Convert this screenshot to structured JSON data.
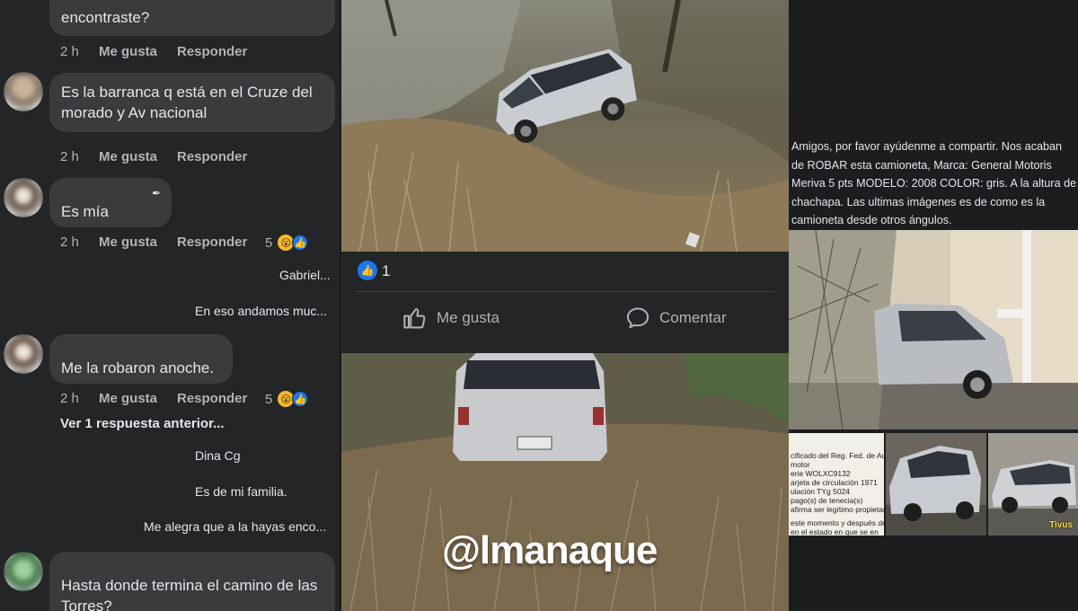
{
  "comments": [
    {
      "text_line2": "encontraste?",
      "time": "2 h",
      "like": "Me gusta",
      "reply": "Responder"
    },
    {
      "text": "Es la barranca q está en el Cruze del morado y Av nacional",
      "time": "2 h",
      "like": "Me gusta",
      "reply": "Responder"
    },
    {
      "text": "Es mía",
      "time": "2 h",
      "like": "Me gusta",
      "reply": "Responder",
      "reaction_count": "5"
    },
    {
      "text": "Me la robaron anoche.",
      "time": "2 h",
      "like": "Me gusta",
      "reply": "Responder",
      "reaction_count": "5"
    },
    {
      "text": "Hasta donde termina el camino de las Torres?"
    }
  ],
  "reply_previews": {
    "gabriel": "Gabriel...",
    "andamos": "En eso andamos muc...",
    "prev_replies": "Ver 1 respuesta anterior...",
    "dina": "Dina Cg",
    "familia": "Es de mi familia.",
    "alegra": "Me alegra que a la hayas enco..."
  },
  "post": {
    "like_count": "1",
    "like_label": "Me gusta",
    "comment_label": "Comentar"
  },
  "watermark": "@lmanaque",
  "right_post": {
    "text": "Amigos, por favor ayúdenme a compartir. Nos acaban de ROBAR esta camioneta, Marca: General Motoris Meriva 5 pts MODELO: 2008  COLOR: gris. A la altura de chachapa. Las ultimas imágenes es de como es la camioneta desde otros ángulos.",
    "doc_lines": [
      "cificado del Reg. Fed. de Aut.",
      "motor",
      "erie   WOLXC9132",
      "arjeta de circulación   1971",
      "ulación   TYg 5024",
      "pago(s) de tenecia(s)",
      "afirma ser legítimo propietario",
      "este momento y después de",
      "en el estado en que se en"
    ],
    "tivus_logo": "Tivus"
  },
  "colors": {
    "accent": "#1877f2",
    "bg": "#242526",
    "bubble": "#3a3b3c",
    "text": "#e4e6eb",
    "muted": "#b0b3b8"
  }
}
